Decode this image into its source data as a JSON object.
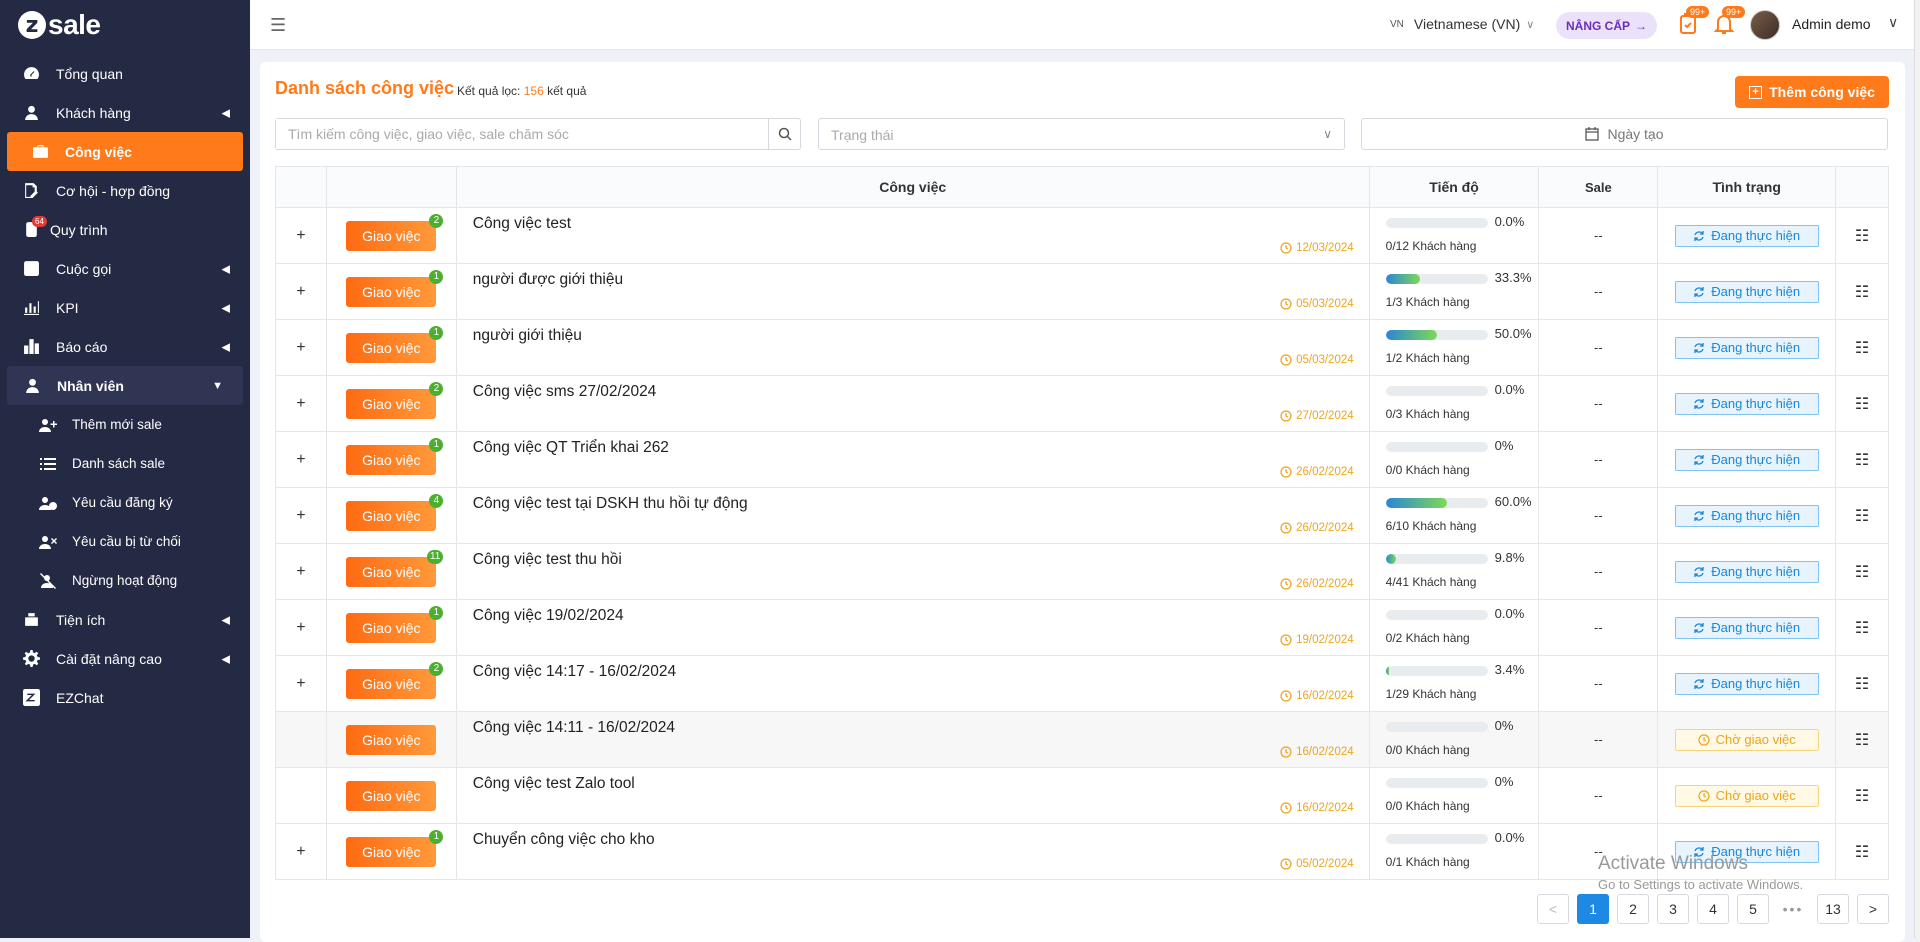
{
  "app": {
    "logo": "sale"
  },
  "sidebar": {
    "items": [
      {
        "label": "Tổng quan",
        "icon": "dashboard-icon"
      },
      {
        "label": "Khách hàng",
        "icon": "user-icon"
      },
      {
        "label": "Công việc",
        "icon": "briefcase-icon"
      },
      {
        "label": "Cơ hội - hợp đồng",
        "icon": "contract-icon"
      },
      {
        "label": "Quy trình",
        "icon": "process-icon",
        "badge": "64"
      },
      {
        "label": "Cuộc gọi",
        "icon": "phone-icon"
      },
      {
        "label": "KPI",
        "icon": "chart-icon"
      },
      {
        "label": "Báo cáo",
        "icon": "report-icon"
      },
      {
        "label": "Nhân viên",
        "icon": "staff-icon"
      },
      {
        "label": "Tiện ích",
        "icon": "utility-icon"
      },
      {
        "label": "Cài đặt nâng cao",
        "icon": "settings-icon"
      },
      {
        "label": "EZChat",
        "icon": "zalo-icon"
      }
    ],
    "sub_items": [
      {
        "label": "Thêm mới sale",
        "icon": "user-plus-icon"
      },
      {
        "label": "Danh sách sale",
        "icon": "list-icon"
      },
      {
        "label": "Yêu cầu đăng ký",
        "icon": "user-clock-icon"
      },
      {
        "label": "Yêu cầu bị từ chối",
        "icon": "user-x-icon"
      },
      {
        "label": "Ngừng hoạt động",
        "icon": "user-slash-icon"
      }
    ]
  },
  "header": {
    "lang_code": "VN",
    "language": "Vietnamese (VN)",
    "upgrade": "NÂNG CẤP",
    "task_badge": "99+",
    "bell_badge": "99+",
    "user": "Admin demo"
  },
  "page": {
    "title": "Danh sách công việc",
    "result_prefix": "Kết quả lọc:",
    "result_count": "156",
    "result_suffix": "kết quả",
    "add_button": "Thêm công việc",
    "search_placeholder": "Tìm kiếm công việc, giao việc, sale chăm sóc",
    "status_placeholder": "Trạng thái",
    "date_placeholder": "Ngày tạo"
  },
  "table": {
    "headers": {
      "task": "Công việc",
      "progress": "Tiến độ",
      "sale": "Sale",
      "status": "Tình trạng"
    },
    "assign_label": "Giao việc",
    "rows": [
      {
        "expand": "+",
        "badge": "2",
        "name": "Công việc test",
        "date": "12/03/2024",
        "pct": "0.0%",
        "fill": 0,
        "customers": "0/12 Khách hàng",
        "sale": "--",
        "status": "Đang thực hiện",
        "kind": "doing"
      },
      {
        "expand": "+",
        "badge": "1",
        "name": "người được giới thiệu",
        "date": "05/03/2024",
        "pct": "33.3%",
        "fill": 33.3,
        "customers": "1/3 Khách hàng",
        "sale": "--",
        "status": "Đang thực hiện",
        "kind": "doing"
      },
      {
        "expand": "+",
        "badge": "1",
        "name": "người giới thiệu",
        "date": "05/03/2024",
        "pct": "50.0%",
        "fill": 50,
        "customers": "1/2 Khách hàng",
        "sale": "--",
        "status": "Đang thực hiện",
        "kind": "doing"
      },
      {
        "expand": "+",
        "badge": "2",
        "name": "Công việc sms 27/02/2024",
        "date": "27/02/2024",
        "pct": "0.0%",
        "fill": 0,
        "customers": "0/3 Khách hàng",
        "sale": "--",
        "status": "Đang thực hiện",
        "kind": "doing"
      },
      {
        "expand": "+",
        "badge": "1",
        "name": "Công việc QT Triển khai 262",
        "date": "26/02/2024",
        "pct": "0%",
        "fill": 0,
        "customers": "0/0 Khách hàng",
        "sale": "--",
        "status": "Đang thực hiện",
        "kind": "doing"
      },
      {
        "expand": "+",
        "badge": "4",
        "name": "Công việc test tại DSKH thu hồi tự động",
        "date": "26/02/2024",
        "pct": "60.0%",
        "fill": 60,
        "customers": "6/10 Khách hàng",
        "sale": "--",
        "status": "Đang thực hiện",
        "kind": "doing"
      },
      {
        "expand": "+",
        "badge": "11",
        "name": "Công việc test thu hồi",
        "date": "26/02/2024",
        "pct": "9.8%",
        "fill": 9.8,
        "customers": "4/41 Khách hàng",
        "sale": "--",
        "status": "Đang thực hiện",
        "kind": "doing"
      },
      {
        "expand": "+",
        "badge": "1",
        "name": "Công việc 19/02/2024",
        "date": "19/02/2024",
        "pct": "0.0%",
        "fill": 0,
        "customers": "0/2 Khách hàng",
        "sale": "--",
        "status": "Đang thực hiện",
        "kind": "doing"
      },
      {
        "expand": "+",
        "badge": "2",
        "name": "Công việc 14:17 - 16/02/2024",
        "date": "16/02/2024",
        "pct": "3.4%",
        "fill": 3.4,
        "customers": "1/29 Khách hàng",
        "sale": "--",
        "status": "Đang thực hiện",
        "kind": "doing"
      },
      {
        "expand": "",
        "badge": "",
        "name": "Công việc 14:11 - 16/02/2024",
        "date": "16/02/2024",
        "pct": "0%",
        "fill": 0,
        "customers": "0/0 Khách hàng",
        "sale": "--",
        "status": "Chờ giao việc",
        "kind": "wait",
        "gray": true
      },
      {
        "expand": "",
        "badge": "",
        "name": "Công việc test Zalo tool",
        "date": "16/02/2024",
        "pct": "0%",
        "fill": 0,
        "customers": "0/0 Khách hàng",
        "sale": "--",
        "status": "Chờ giao việc",
        "kind": "wait"
      },
      {
        "expand": "+",
        "badge": "1",
        "name": "Chuyển công việc cho kho",
        "date": "05/02/2024",
        "pct": "0.0%",
        "fill": 0,
        "customers": "0/1 Khách hàng",
        "sale": "--",
        "status": "Đang thực hiện",
        "kind": "doing"
      }
    ]
  },
  "pagination": {
    "prev": "<",
    "pages": [
      "1",
      "2",
      "3",
      "4",
      "5"
    ],
    "dots": "•••",
    "last": "13",
    "next": ">"
  },
  "watermark": {
    "line1": "Activate Windows",
    "line2": "Go to Settings to activate Windows."
  },
  "colors": {
    "accent": "#ff7a1a",
    "sidebar": "#252a44",
    "doing": "#1a86d8",
    "wait": "#f0a31a",
    "badge": "#4caf2e"
  }
}
